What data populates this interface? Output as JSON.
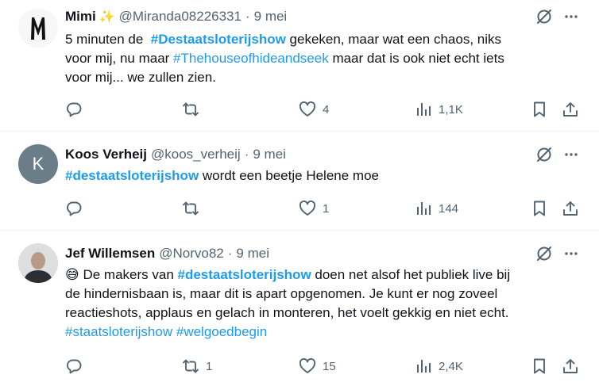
{
  "tweets": [
    {
      "name": "Mimi",
      "handle": "@Miranda08226331",
      "sep": "·",
      "date": "9 mei",
      "emoji_after_name": "✨",
      "text_parts": [
        {
          "t": "5 minuten de  "
        },
        {
          "t": "#Destaatsloterijshow",
          "tag": true,
          "bold": true
        },
        {
          "t": " gekeken, maar wat een chaos, niks\nvoor mij, nu maar "
        },
        {
          "t": "#Thehouseofhideandseek",
          "tag": true
        },
        {
          "t": " maar dat is ook niet echt iets\nvoor mij... we zullen zien."
        }
      ],
      "actions": {
        "reply": "",
        "repost": "",
        "like": "4",
        "views": "1,1K"
      }
    },
    {
      "name": "Koos Verheij",
      "handle": "@koos_verheij",
      "sep": "·",
      "date": "9 mei",
      "avatar_letter": "K",
      "text_parts": [
        {
          "t": "#destaatsloterijshow",
          "tag": true,
          "bold": true
        },
        {
          "t": " wordt een beetje Helene moe"
        }
      ],
      "actions": {
        "reply": "",
        "repost": "",
        "like": "1",
        "views": "144"
      }
    },
    {
      "name": "Jef Willemsen",
      "handle": "@Norvo82",
      "sep": "·",
      "date": "9 mei",
      "text_parts": [
        {
          "t": "😅",
          "emoji": true
        },
        {
          "t": " De makers van "
        },
        {
          "t": "#destaatsloterijshow",
          "tag": true,
          "bold": true
        },
        {
          "t": " doen net alsof het publiek live bij\nde hindernisbaan is, maar dit is apart opgenomen. Je kunt er nog zoveel\nreactieshots, applaus en gelach in monteren, het voelt gekkig en niet echt.\n"
        },
        {
          "t": "#staatsloterijshow",
          "tag": true
        },
        {
          "t": " "
        },
        {
          "t": "#welgoedbegin",
          "tag": true
        }
      ],
      "actions": {
        "reply": "",
        "repost": "1",
        "like": "15",
        "views": "2,4K"
      }
    }
  ],
  "colors": {
    "link": "#1d9bf0",
    "muted": "#536471",
    "text": "#0f1419",
    "border": "#eff3f4"
  }
}
